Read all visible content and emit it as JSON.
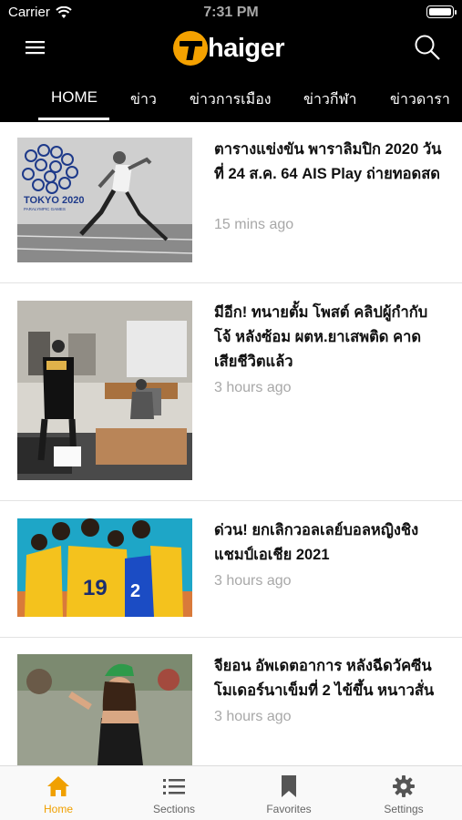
{
  "status_bar": {
    "carrier": "Carrier",
    "time": "7:31 PM"
  },
  "header": {
    "logo_text": "haiger",
    "brand_color": "#f4a100"
  },
  "tabs": [
    {
      "label": "HOME",
      "active": true
    },
    {
      "label": "ข่าว"
    },
    {
      "label": "ข่าวการเมือง"
    },
    {
      "label": "ข่าวกีฬา"
    },
    {
      "label": "ข่าวดารา"
    }
  ],
  "articles": [
    {
      "title": "ตารางแข่งขัน พาราลิมปิก 2020 วันที่ 24 ส.ค. 64 AIS Play ถ่ายทอดสด",
      "time": "15 mins ago",
      "image_text": "TOKYO 2020",
      "image_subtext": "PARALYMPIC GAMES"
    },
    {
      "title": "มีอีก! ทนายตั้ม โพสต์ คลิปผู้กำกับ โจ้ หลังซ้อม ผตห.ยาเสพติด คาด เสียชีวิตแล้ว",
      "time": "3 hours ago"
    },
    {
      "title": "ด่วน! ยกเลิกวอลเลย์บอลหญิงชิง แชมป์เอเชีย 2021",
      "time": "3 hours ago",
      "jersey_a": "19",
      "jersey_b": "2"
    },
    {
      "title": "จียอน อัพเดตอาการ หลังฉีดวัคซีน โมเดอร์นาเข็มที่ 2 ไข้ขึ้น หนาวสั่น",
      "time": "3 hours ago"
    }
  ],
  "bottom_tabs": [
    {
      "label": "Home",
      "icon": "home-icon",
      "active": true
    },
    {
      "label": "Sections",
      "icon": "list-icon"
    },
    {
      "label": "Favorites",
      "icon": "bookmark-icon"
    },
    {
      "label": "Settings",
      "icon": "gear-icon"
    }
  ],
  "colors": {
    "accent": "#f0a000",
    "header_bg": "#000000",
    "muted_text": "#a8a8a8"
  }
}
